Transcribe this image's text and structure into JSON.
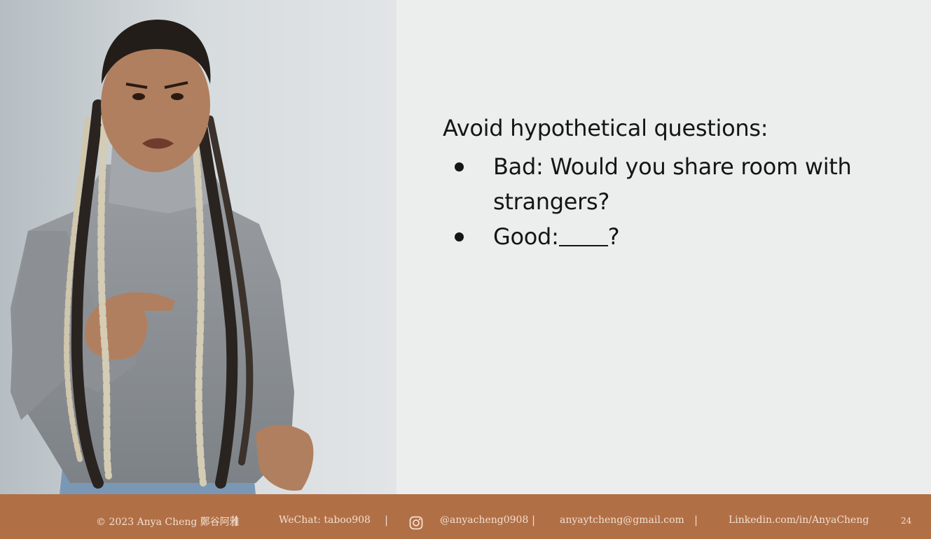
{
  "slide": {
    "heading": "Avoid hypothetical questions:",
    "bullets": [
      {
        "label": "Bad: Would you share room with strangers?"
      },
      {
        "prefix": "Good:",
        "suffix": "?"
      }
    ]
  },
  "footer": {
    "copyright": "© 2023 Anya Cheng 鄭谷阿雅",
    "wechat": "WeChat: taboo908",
    "instagram": "@anyacheng0908",
    "email": "anyaytcheng@gmail.com",
    "linkedin": "Linkedin.com/in/AnyaCheng",
    "page_number": "24",
    "separator": "||",
    "separator_single": "|"
  },
  "colors": {
    "footer_bg": "#b16f46",
    "footer_text": "#f2dfcf",
    "slide_bg": "#eceeed",
    "text": "#151515"
  },
  "icons": [
    "instagram-icon"
  ]
}
